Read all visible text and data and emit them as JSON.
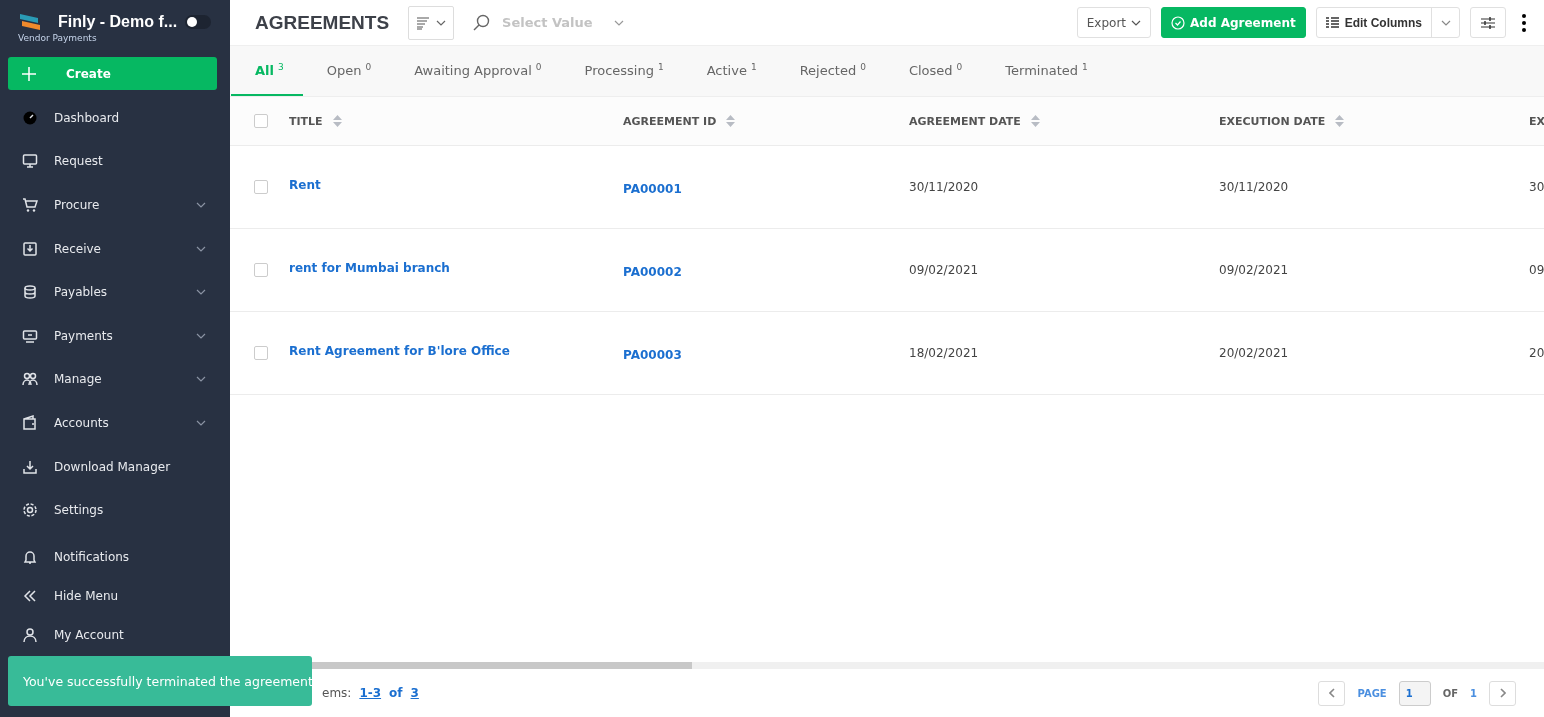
{
  "brand": {
    "name": "Finly - Demo f...",
    "subtitle": "Vendor Payments",
    "switch_on": false
  },
  "create_button": "Create",
  "nav": [
    {
      "label": "Dashboard",
      "expandable": false
    },
    {
      "label": "Request",
      "expandable": false
    },
    {
      "label": "Procure",
      "expandable": true
    },
    {
      "label": "Receive",
      "expandable": true
    },
    {
      "label": "Payables",
      "expandable": true
    },
    {
      "label": "Payments",
      "expandable": true
    },
    {
      "label": "Manage",
      "expandable": true
    },
    {
      "label": "Accounts",
      "expandable": true
    },
    {
      "label": "Download Manager",
      "expandable": false
    },
    {
      "label": "Settings",
      "expandable": false
    }
  ],
  "bottom_nav": [
    "Notifications",
    "Hide Menu",
    "My Account"
  ],
  "header": {
    "title": "AGREEMENTS",
    "search_placeholder": "Select Value",
    "export": "Export",
    "add": "Add Agreement",
    "edit_columns": "Edit Columns"
  },
  "tabs": [
    {
      "label": "All",
      "count": "3",
      "selected": true
    },
    {
      "label": "Open",
      "count": "0",
      "selected": false
    },
    {
      "label": "Awaiting Approval",
      "count": "0",
      "selected": false
    },
    {
      "label": "Processing",
      "count": "1",
      "selected": false
    },
    {
      "label": "Active",
      "count": "1",
      "selected": false
    },
    {
      "label": "Rejected",
      "count": "0",
      "selected": false
    },
    {
      "label": "Closed",
      "count": "0",
      "selected": false
    },
    {
      "label": "Terminated",
      "count": "1",
      "selected": false
    }
  ],
  "table": {
    "all_checked": false,
    "columns": [
      "TITLE",
      "AGREEMENT ID",
      "AGREEMENT DATE",
      "EXECUTION DATE",
      "EX"
    ],
    "rows": [
      {
        "checked": false,
        "cells": [
          "Rent",
          "PA00001",
          "30/11/2020",
          "30/11/2020",
          "30"
        ]
      },
      {
        "checked": false,
        "cells": [
          "rent for Mumbai branch",
          "PA00002",
          "09/02/2021",
          "09/02/2021",
          "09"
        ]
      },
      {
        "checked": false,
        "cells": [
          "Rent Agreement for B'lore Office",
          "PA00003",
          "18/02/2021",
          "20/02/2021",
          "20"
        ]
      }
    ]
  },
  "footer": {
    "items_label": "ems:",
    "range": "1-3",
    "of": "of",
    "total": "3",
    "page_label": "PAGE",
    "page": "1",
    "page_of": "OF",
    "pages": "1"
  },
  "toast": "You've successfully terminated the agreement"
}
